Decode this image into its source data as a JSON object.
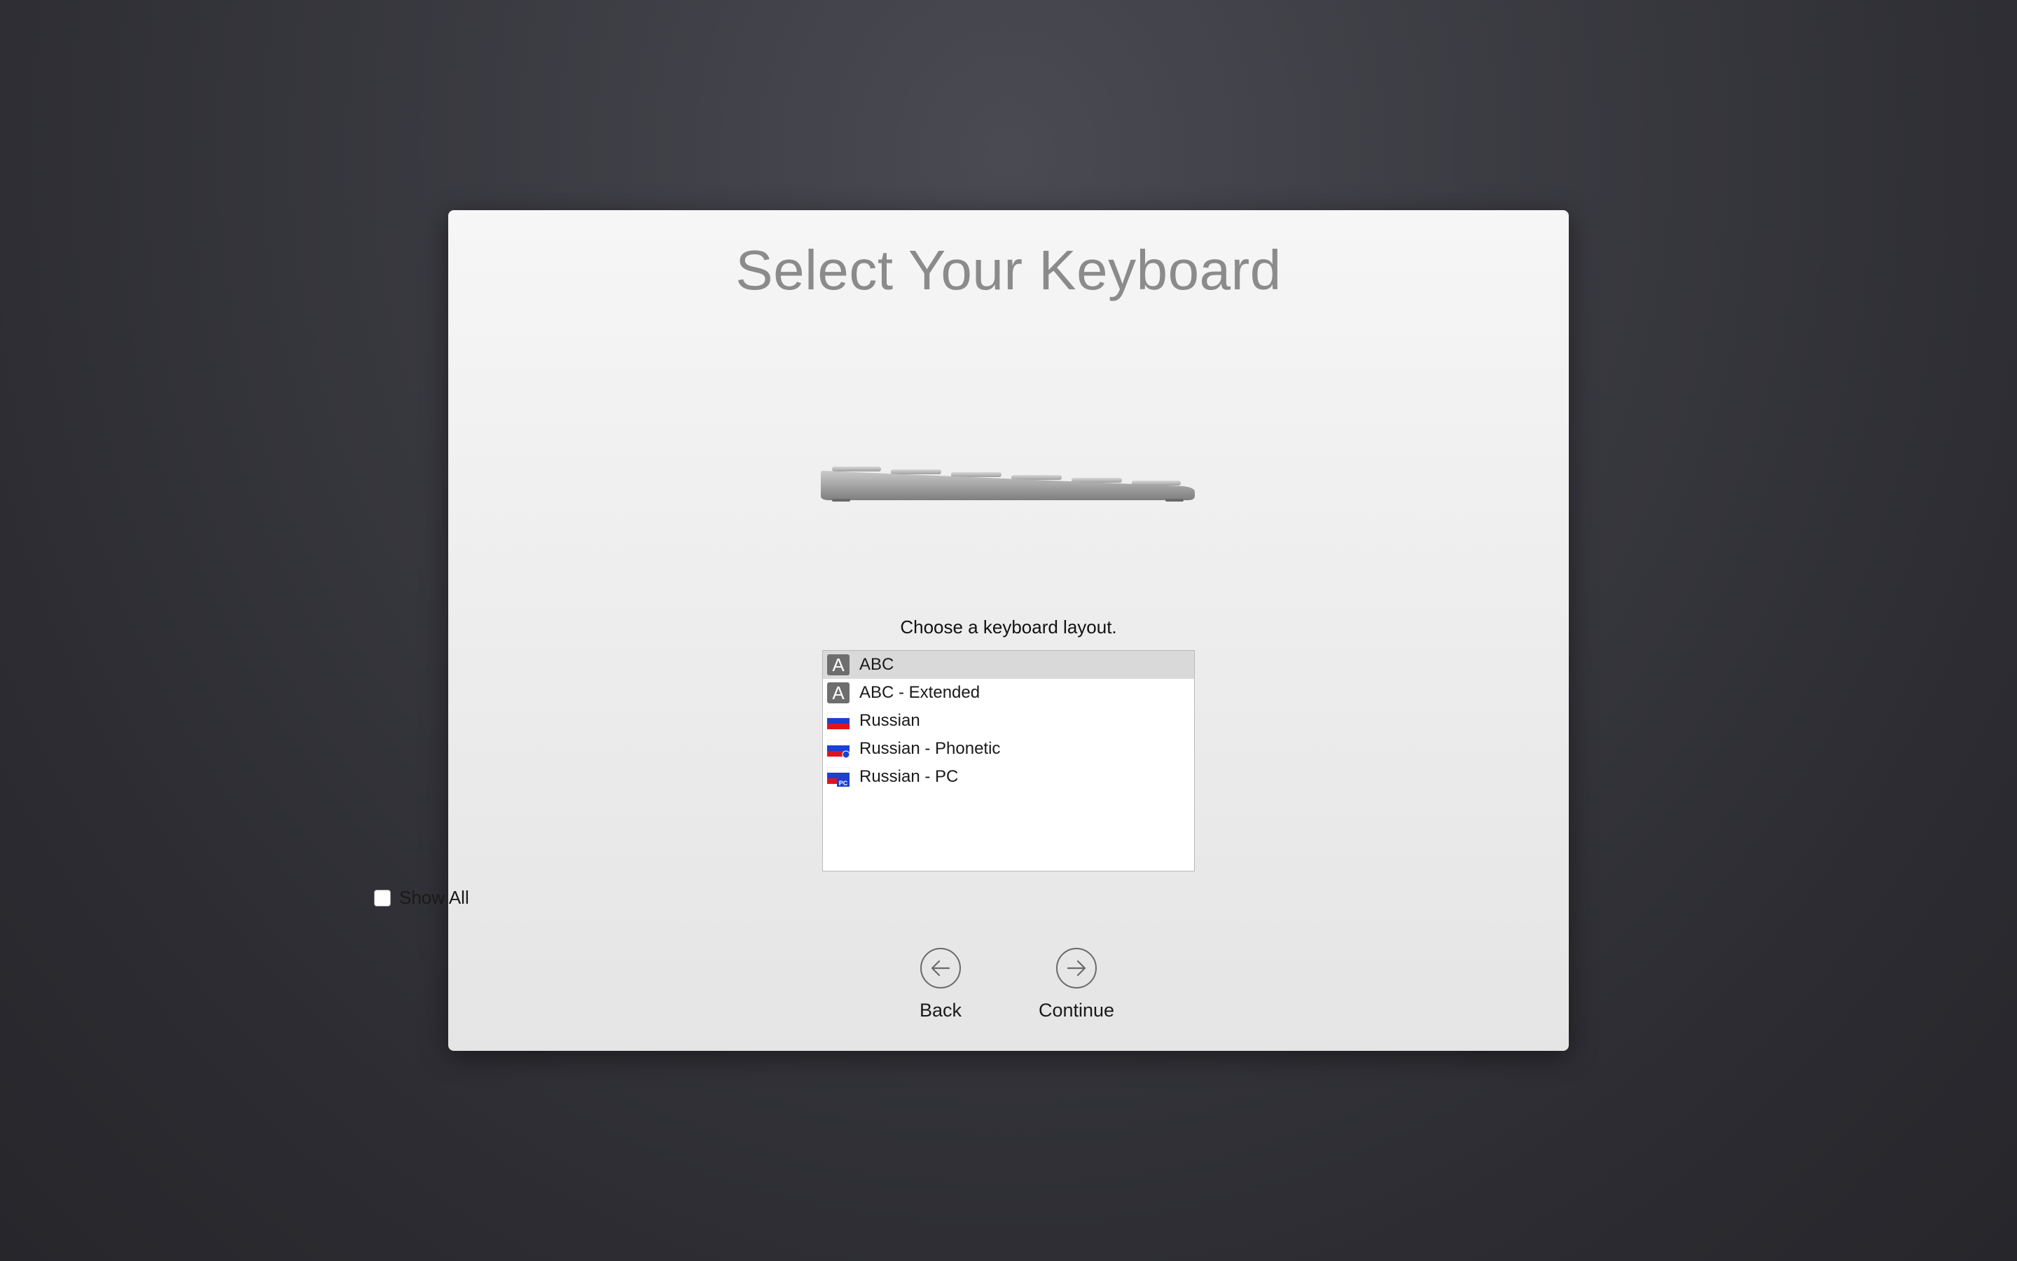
{
  "dialog": {
    "title": "Select Your Keyboard",
    "prompt": "Choose a keyboard layout."
  },
  "layouts": [
    {
      "label": "ABC",
      "icon": "abc-input-icon",
      "selected": true
    },
    {
      "label": "ABC - Extended",
      "icon": "abc-input-icon",
      "selected": false
    },
    {
      "label": "Russian",
      "icon": "russian-flag-icon",
      "selected": false
    },
    {
      "label": "Russian - Phonetic",
      "icon": "russian-flag-phonetic-icon",
      "selected": false
    },
    {
      "label": "Russian - PC",
      "icon": "russian-flag-pc-icon",
      "selected": false
    }
  ],
  "icon_text": {
    "abc": "A",
    "pc_badge": "PC"
  },
  "show_all": {
    "label": "Show All",
    "checked": false
  },
  "nav": {
    "back_label": "Back",
    "continue_label": "Continue"
  },
  "colors": {
    "selected_row": "#d9d9d9",
    "title": "#8b8b8b",
    "flag_white": "#ffffff",
    "flag_blue": "#1c3fd4",
    "flag_red": "#e0141e"
  }
}
